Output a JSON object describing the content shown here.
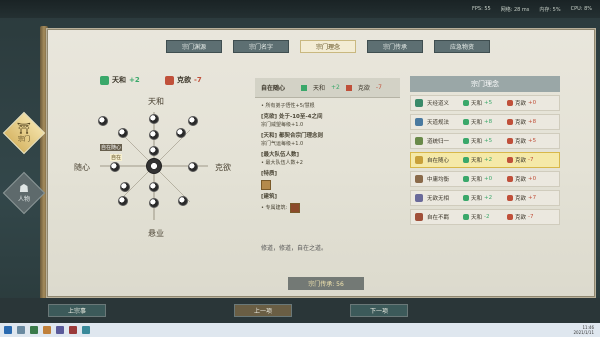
{
  "topbar": {
    "fps": "FPS: 55",
    "net": "网络: 28 ms",
    "mem": "内存: 5%",
    "cpu": "CPU: 8%"
  },
  "side_tabs": [
    {
      "label": "宗门",
      "icon": "sect-icon",
      "active": true
    },
    {
      "label": "人物",
      "icon": "person-icon",
      "active": false
    }
  ],
  "tabs": [
    {
      "label": "宗门渊源",
      "active": false
    },
    {
      "label": "宗门名字",
      "active": false
    },
    {
      "label": "宗门理念",
      "active": true
    },
    {
      "label": "宗门传承",
      "active": false
    },
    {
      "label": "应急物资",
      "active": false
    }
  ],
  "diagram": {
    "tianhe_label": "天和",
    "tianhe_value": "+2",
    "keyu_label": "克欲",
    "keyu_value": "-7",
    "top_label": "天和",
    "left_label": "随心",
    "right_label": "克欲",
    "bottom_label": "悬业",
    "node_labels": [
      "自在随心",
      "自在"
    ]
  },
  "mid": {
    "title": "自在随心",
    "tianhe": "天和",
    "tianhe_val": "+2",
    "keyu": "克欲",
    "keyu_val": "-7",
    "lines": [
      "• 所有弟子悟性+5/慧根",
      "[克欲]  处于-10至-4之间",
      "宗门威望每级+1.0",
      "[天和]  都契合宗门理念则",
      "宗门气运每级+1.0",
      "[最大队伍人数]",
      "• 最大队伍人数+2",
      "[特质]",
      "[建筑]",
      "• 专属建筑: "
    ],
    "footer": "修道，修道，自在之道。"
  },
  "right": {
    "title": "宗门理念",
    "rows": [
      {
        "name": "天经道义",
        "a_label": "天和",
        "a_val": "+5",
        "b_label": "克欲",
        "b_val": "+0",
        "selected": false
      },
      {
        "name": "天道规法",
        "a_label": "天和",
        "a_val": "+8",
        "b_label": "克欲",
        "b_val": "+8",
        "selected": false
      },
      {
        "name": "道统归一",
        "a_label": "天和",
        "a_val": "+5",
        "b_label": "克欲",
        "b_val": "+5",
        "selected": false
      },
      {
        "name": "自在随心",
        "a_label": "天和",
        "a_val": "+2",
        "b_label": "克欲",
        "b_val": "-7",
        "selected": true
      },
      {
        "name": "中庸均衡",
        "a_label": "天和",
        "a_val": "+0",
        "b_label": "克欲",
        "b_val": "+0",
        "selected": false
      },
      {
        "name": "无欲无相",
        "a_label": "天和",
        "a_val": "+2",
        "b_label": "克欲",
        "b_val": "+7",
        "selected": false
      },
      {
        "name": "自在不羁",
        "a_label": "天和",
        "a_val": "-2",
        "b_label": "克欲",
        "b_val": "-7",
        "selected": false
      }
    ]
  },
  "footer": {
    "tag": "宗门传承: 56",
    "left_btn": "上宗事",
    "prev_btn": "上一项",
    "next_btn": "下一项"
  },
  "taskbar": {
    "time": "11:46",
    "date": "2021/1/11"
  },
  "colors": {
    "tianhe": "#3aa86a",
    "keyu": "#c0503a",
    "accent": "#d8b84a"
  }
}
